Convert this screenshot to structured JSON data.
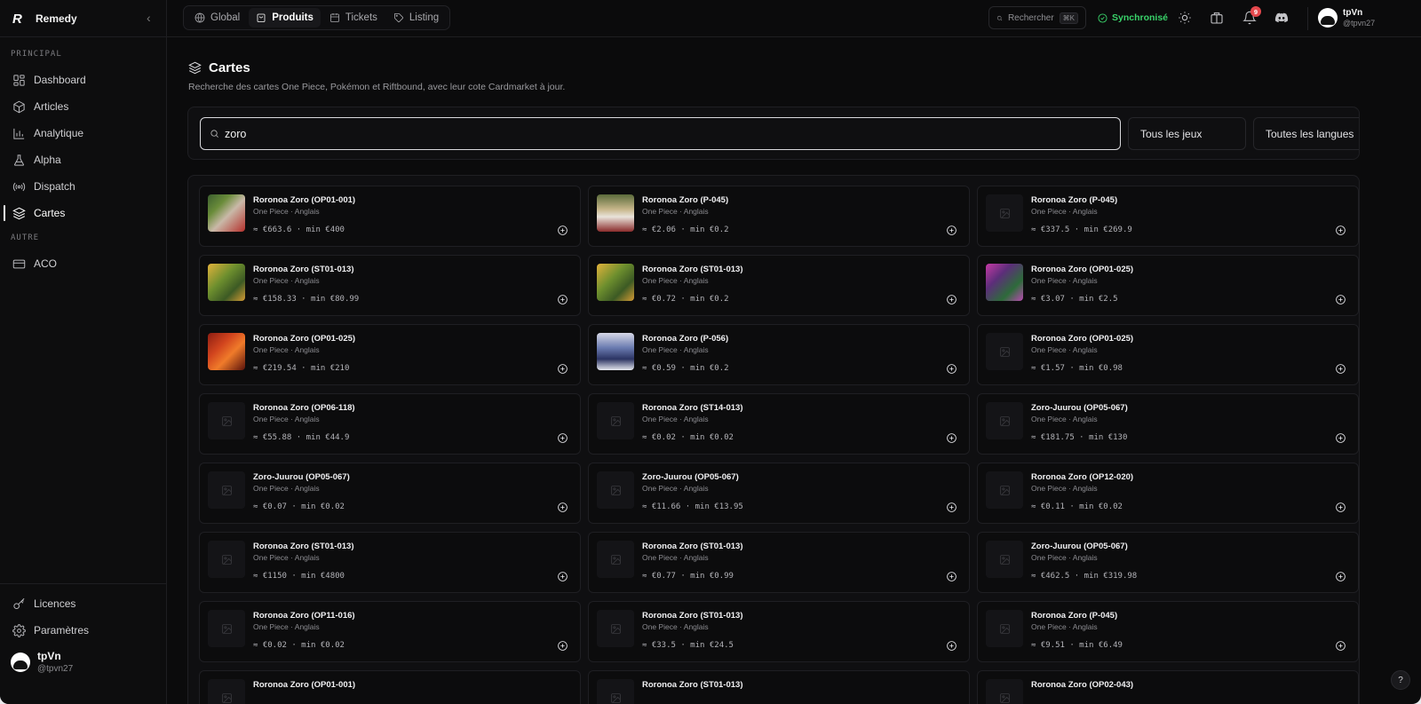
{
  "app": {
    "logo": "R",
    "name": "Remedy"
  },
  "sidebar": {
    "section_principal": "PRINCIPAL",
    "section_autre": "AUTRE",
    "items": [
      {
        "label": "Dashboard",
        "icon": "grid-icon"
      },
      {
        "label": "Articles",
        "icon": "box-icon"
      },
      {
        "label": "Analytique",
        "icon": "bar-chart-icon"
      },
      {
        "label": "Alpha",
        "icon": "flask-icon"
      },
      {
        "label": "Dispatch",
        "icon": "radio-icon"
      },
      {
        "label": "Cartes",
        "icon": "layers-icon",
        "active": true
      }
    ],
    "autre_items": [
      {
        "label": "ACO",
        "icon": "card-icon"
      }
    ],
    "bottom_items": [
      {
        "label": "Licences",
        "icon": "key-icon"
      },
      {
        "label": "Paramètres",
        "icon": "gear-icon"
      }
    ],
    "user": {
      "name": "tpVn",
      "handle": "@tpvn27"
    }
  },
  "topbar": {
    "tabs": [
      {
        "label": "Global",
        "icon": "globe-icon"
      },
      {
        "label": "Produits",
        "icon": "bag-icon",
        "active": true
      },
      {
        "label": "Tickets",
        "icon": "calendar-icon"
      },
      {
        "label": "Listing",
        "icon": "tag-icon"
      }
    ],
    "search_label": "Rechercher",
    "search_shortcut": "⌘K",
    "sync_status": "Synchronisé",
    "notification_count": "9",
    "user": {
      "name": "tpVn",
      "handle": "@tpvn27"
    }
  },
  "page": {
    "title": "Cartes",
    "subtitle": "Recherche des cartes One Piece, Pokémon et Riftbound, avec leur cote Cardmarket à jour.",
    "search_value": "zoro",
    "game_filter": "Tous les jeux",
    "language_filter": "Toutes les langues"
  },
  "cards": [
    {
      "name": "Roronoa Zoro (OP01-001)",
      "meta": "One Piece · Anglais",
      "price": "≈ €663.6 · min €400",
      "thumb": "art-red"
    },
    {
      "name": "Roronoa Zoro (P-045)",
      "meta": "One Piece · Anglais",
      "price": "≈ €2.06 · min €0.2",
      "thumb": "art-sample"
    },
    {
      "name": "Roronoa Zoro (P-045)",
      "meta": "One Piece · Anglais",
      "price": "≈ €337.5 · min €269.9",
      "thumb": "none"
    },
    {
      "name": "Roronoa Zoro (ST01-013)",
      "meta": "One Piece · Anglais",
      "price": "≈ €158.33 · min €80.99",
      "thumb": "art-green"
    },
    {
      "name": "Roronoa Zoro (ST01-013)",
      "meta": "One Piece · Anglais",
      "price": "≈ €0.72 · min €0.2",
      "thumb": "art-green"
    },
    {
      "name": "Roronoa Zoro (OP01-025)",
      "meta": "One Piece · Anglais",
      "price": "≈ €3.07 · min €2.5",
      "thumb": "art-purple"
    },
    {
      "name": "Roronoa Zoro (OP01-025)",
      "meta": "One Piece · Anglais",
      "price": "≈ €219.54 · min €210",
      "thumb": "art-fire"
    },
    {
      "name": "Roronoa Zoro (P-056)",
      "meta": "One Piece · Anglais",
      "price": "≈ €0.59 · min €0.2",
      "thumb": "art-blue"
    },
    {
      "name": "Roronoa Zoro (OP01-025)",
      "meta": "One Piece · Anglais",
      "price": "≈ €1.57 · min €0.98",
      "thumb": "none"
    },
    {
      "name": "Roronoa Zoro (OP06-118)",
      "meta": "One Piece · Anglais",
      "price": "≈ €55.88 · min €44.9",
      "thumb": "none"
    },
    {
      "name": "Roronoa Zoro (ST14-013)",
      "meta": "One Piece · Anglais",
      "price": "≈ €0.02 · min €0.02",
      "thumb": "none"
    },
    {
      "name": "Zoro-Juurou (OP05-067)",
      "meta": "One Piece · Anglais",
      "price": "≈ €181.75 · min €130",
      "thumb": "none"
    },
    {
      "name": "Zoro-Juurou (OP05-067)",
      "meta": "One Piece · Anglais",
      "price": "≈ €0.07 · min €0.02",
      "thumb": "none"
    },
    {
      "name": "Zoro-Juurou (OP05-067)",
      "meta": "One Piece · Anglais",
      "price": "≈ €11.66 · min €13.95",
      "thumb": "none"
    },
    {
      "name": "Roronoa Zoro (OP12-020)",
      "meta": "One Piece · Anglais",
      "price": "≈ €0.11 · min €0.02",
      "thumb": "none"
    },
    {
      "name": "Roronoa Zoro (ST01-013)",
      "meta": "One Piece · Anglais",
      "price": "≈ €1150 · min €4800",
      "thumb": "none"
    },
    {
      "name": "Roronoa Zoro (ST01-013)",
      "meta": "One Piece · Anglais",
      "price": "≈ €0.77 · min €0.99",
      "thumb": "none"
    },
    {
      "name": "Zoro-Juurou (OP05-067)",
      "meta": "One Piece · Anglais",
      "price": "≈ €462.5 · min €319.98",
      "thumb": "none"
    },
    {
      "name": "Roronoa Zoro (OP11-016)",
      "meta": "One Piece · Anglais",
      "price": "≈ €0.02 · min €0.02",
      "thumb": "none"
    },
    {
      "name": "Roronoa Zoro (ST01-013)",
      "meta": "One Piece · Anglais",
      "price": "≈ €33.5 · min €24.5",
      "thumb": "none"
    },
    {
      "name": "Roronoa Zoro (P-045)",
      "meta": "One Piece · Anglais",
      "price": "≈ €9.51 · min €6.49",
      "thumb": "none"
    },
    {
      "name": "Roronoa Zoro (OP01-001)",
      "meta": "",
      "price": "",
      "thumb": "none"
    },
    {
      "name": "Roronoa Zoro (ST01-013)",
      "meta": "",
      "price": "",
      "thumb": "none"
    },
    {
      "name": "Roronoa Zoro (OP02-043)",
      "meta": "",
      "price": "",
      "thumb": "none"
    }
  ],
  "help_label": "?"
}
